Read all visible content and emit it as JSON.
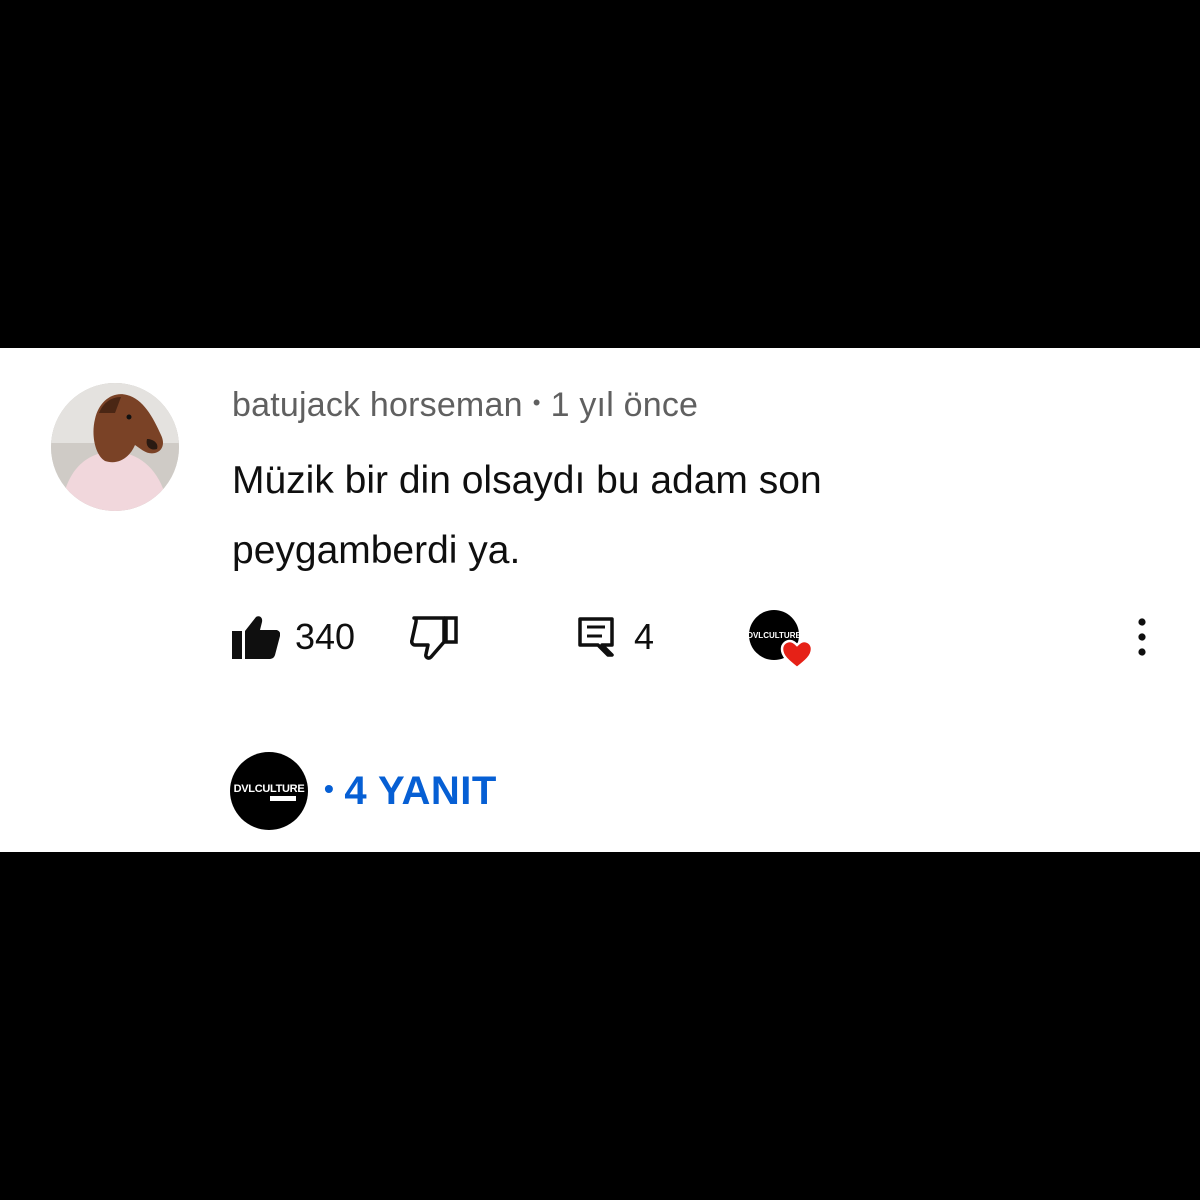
{
  "comment": {
    "author": "batujack horseman",
    "separator": "•",
    "timestamp": "1 yıl önce",
    "text": "Müzik bir din olsaydı bu adam son peygamberdi ya.",
    "like_count": "340",
    "reply_count": "4",
    "creator_heart_logo": "DVLCULTURE"
  },
  "replies": {
    "logo": "DVLCULTURE",
    "separator": "•",
    "label": "4 YANIT"
  },
  "colors": {
    "link_blue": "#065fd4",
    "heart_red": "#e62117",
    "meta_gray": "#606060",
    "text_black": "#0f0f0f"
  },
  "icons": [
    "like-icon",
    "dislike-icon",
    "reply-icon",
    "heart-icon",
    "more-vert-icon"
  ]
}
